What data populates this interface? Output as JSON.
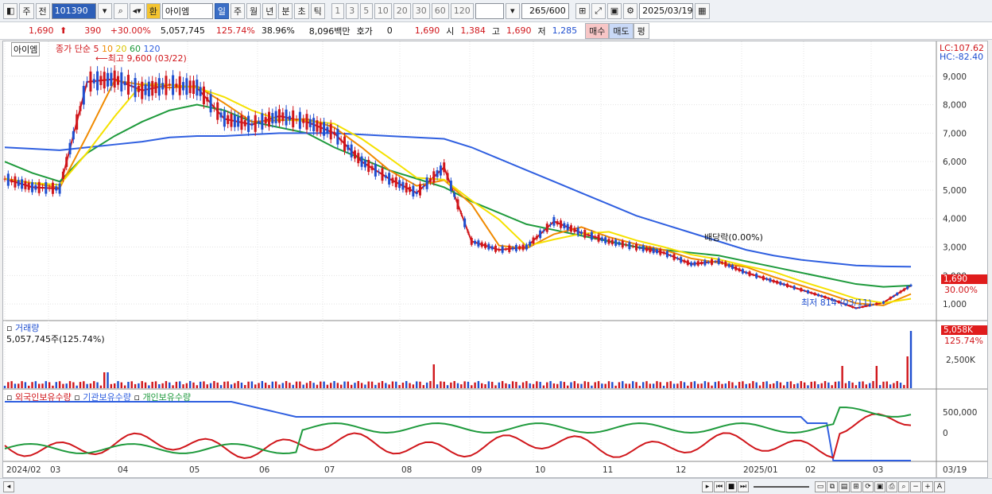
{
  "toolbar": {
    "period_label": "주",
    "prev_label": "전",
    "stock_code": "101390",
    "currency_label": "환",
    "stock_name": "아이엠",
    "timeframes": [
      "일",
      "주",
      "월",
      "년",
      "분",
      "초",
      "틱"
    ],
    "active_timeframe": "일",
    "numbers": [
      "1",
      "3",
      "5",
      "10",
      "20",
      "30",
      "60",
      "120"
    ],
    "count_value": "265",
    "count_total": "/600",
    "date_value": "2025/03/19"
  },
  "info": {
    "price": "1,690",
    "change": "390",
    "change_pct": "+30.00%",
    "volume": "5,057,745",
    "vol_ratio": "125.74%",
    "turnover": "38.96%",
    "amount": "8,096백만",
    "quote_label": "호가",
    "quote_value": "0",
    "quote_price": "1,690",
    "open_label": "시",
    "open_value": "1,384",
    "high_label": "고",
    "high_value": "1,690",
    "low_label": "저",
    "low_value": "1,285",
    "buy_label": "매수",
    "sell_label": "매도",
    "eval_label": "평"
  },
  "price_panel": {
    "stock_tag": "아이엠",
    "ma_label": "종가 단순",
    "ma_periods": [
      "5",
      "10",
      "20",
      "60",
      "120"
    ],
    "high_annotation": "최고 9,600 (03/22)",
    "low_annotation": "최저 814 (03/11)",
    "dividend_annotation": "배당락(0.00%)",
    "lc_label": "LC:107.62",
    "hc_label": "HC:-82.40",
    "y_ticks": [
      "9,000",
      "8,000",
      "7,000",
      "6,000",
      "5,000",
      "4,000",
      "3,000",
      "2,000",
      "1,000"
    ],
    "price_tag": "1,690",
    "pct_tag": "30.00%"
  },
  "volume_panel": {
    "title": "거래량",
    "value_label": "5,057,745주(125.74%)",
    "tag": "5,058K",
    "tag_pct": "125.74%",
    "y_tick": "2,500K"
  },
  "holdings_panel": {
    "legend": [
      "외국인보유수량",
      "기관보유수량",
      "개인보유수량"
    ],
    "y_ticks": [
      "500,000",
      "0"
    ]
  },
  "x_axis": [
    "2024/02",
    "03",
    "04",
    "05",
    "06",
    "07",
    "08",
    "09",
    "10",
    "11",
    "12",
    "2025/01",
    "02",
    "03"
  ],
  "x_axis_end": "03/19",
  "colors": {
    "ma5": "#d0161b",
    "ma10": "#f08a00",
    "ma20": "#f5e100",
    "ma60": "#1e9a3c",
    "ma120": "#2f5fe0",
    "up": "#d0161b",
    "down": "#1f4fd0"
  },
  "chart_data": [
    {
      "type": "line",
      "title": "",
      "series": [
        {
          "name": "5",
          "values": [
            5400,
            5100,
            5050,
            8800,
            8900,
            8500,
            8700,
            8600,
            7500,
            7300,
            7600,
            7400,
            7000,
            6000,
            5400,
            4900,
            5800,
            3200,
            2900,
            3000,
            3900,
            3500,
            3200,
            3000,
            2800,
            2400,
            2500,
            2100,
            1800,
            1500,
            1200,
            850,
            1050,
            1650
          ]
        },
        {
          "name": "60",
          "values": [
            6000,
            5600,
            5300,
            6300,
            6900,
            7400,
            7800,
            8000,
            7800,
            7400,
            7200,
            7000,
            6500,
            6100,
            5700,
            5400,
            5100,
            4600,
            4200,
            3800,
            3600,
            3400,
            3200,
            3000,
            2900,
            2800,
            2700,
            2500,
            2300,
            2100,
            1900,
            1700,
            1600,
            1650
          ]
        },
        {
          "name": "120",
          "values": [
            6500,
            6450,
            6400,
            6500,
            6600,
            6700,
            6850,
            6900,
            6900,
            6950,
            7000,
            7000,
            7000,
            6950,
            6900,
            6850,
            6800,
            6500,
            6100,
            5700,
            5300,
            4900,
            4500,
            4100,
            3800,
            3500,
            3200,
            2900,
            2700,
            2550,
            2450,
            2350,
            2320,
            2310
          ]
        }
      ],
      "ylim": [
        500,
        10000
      ]
    }
  ]
}
